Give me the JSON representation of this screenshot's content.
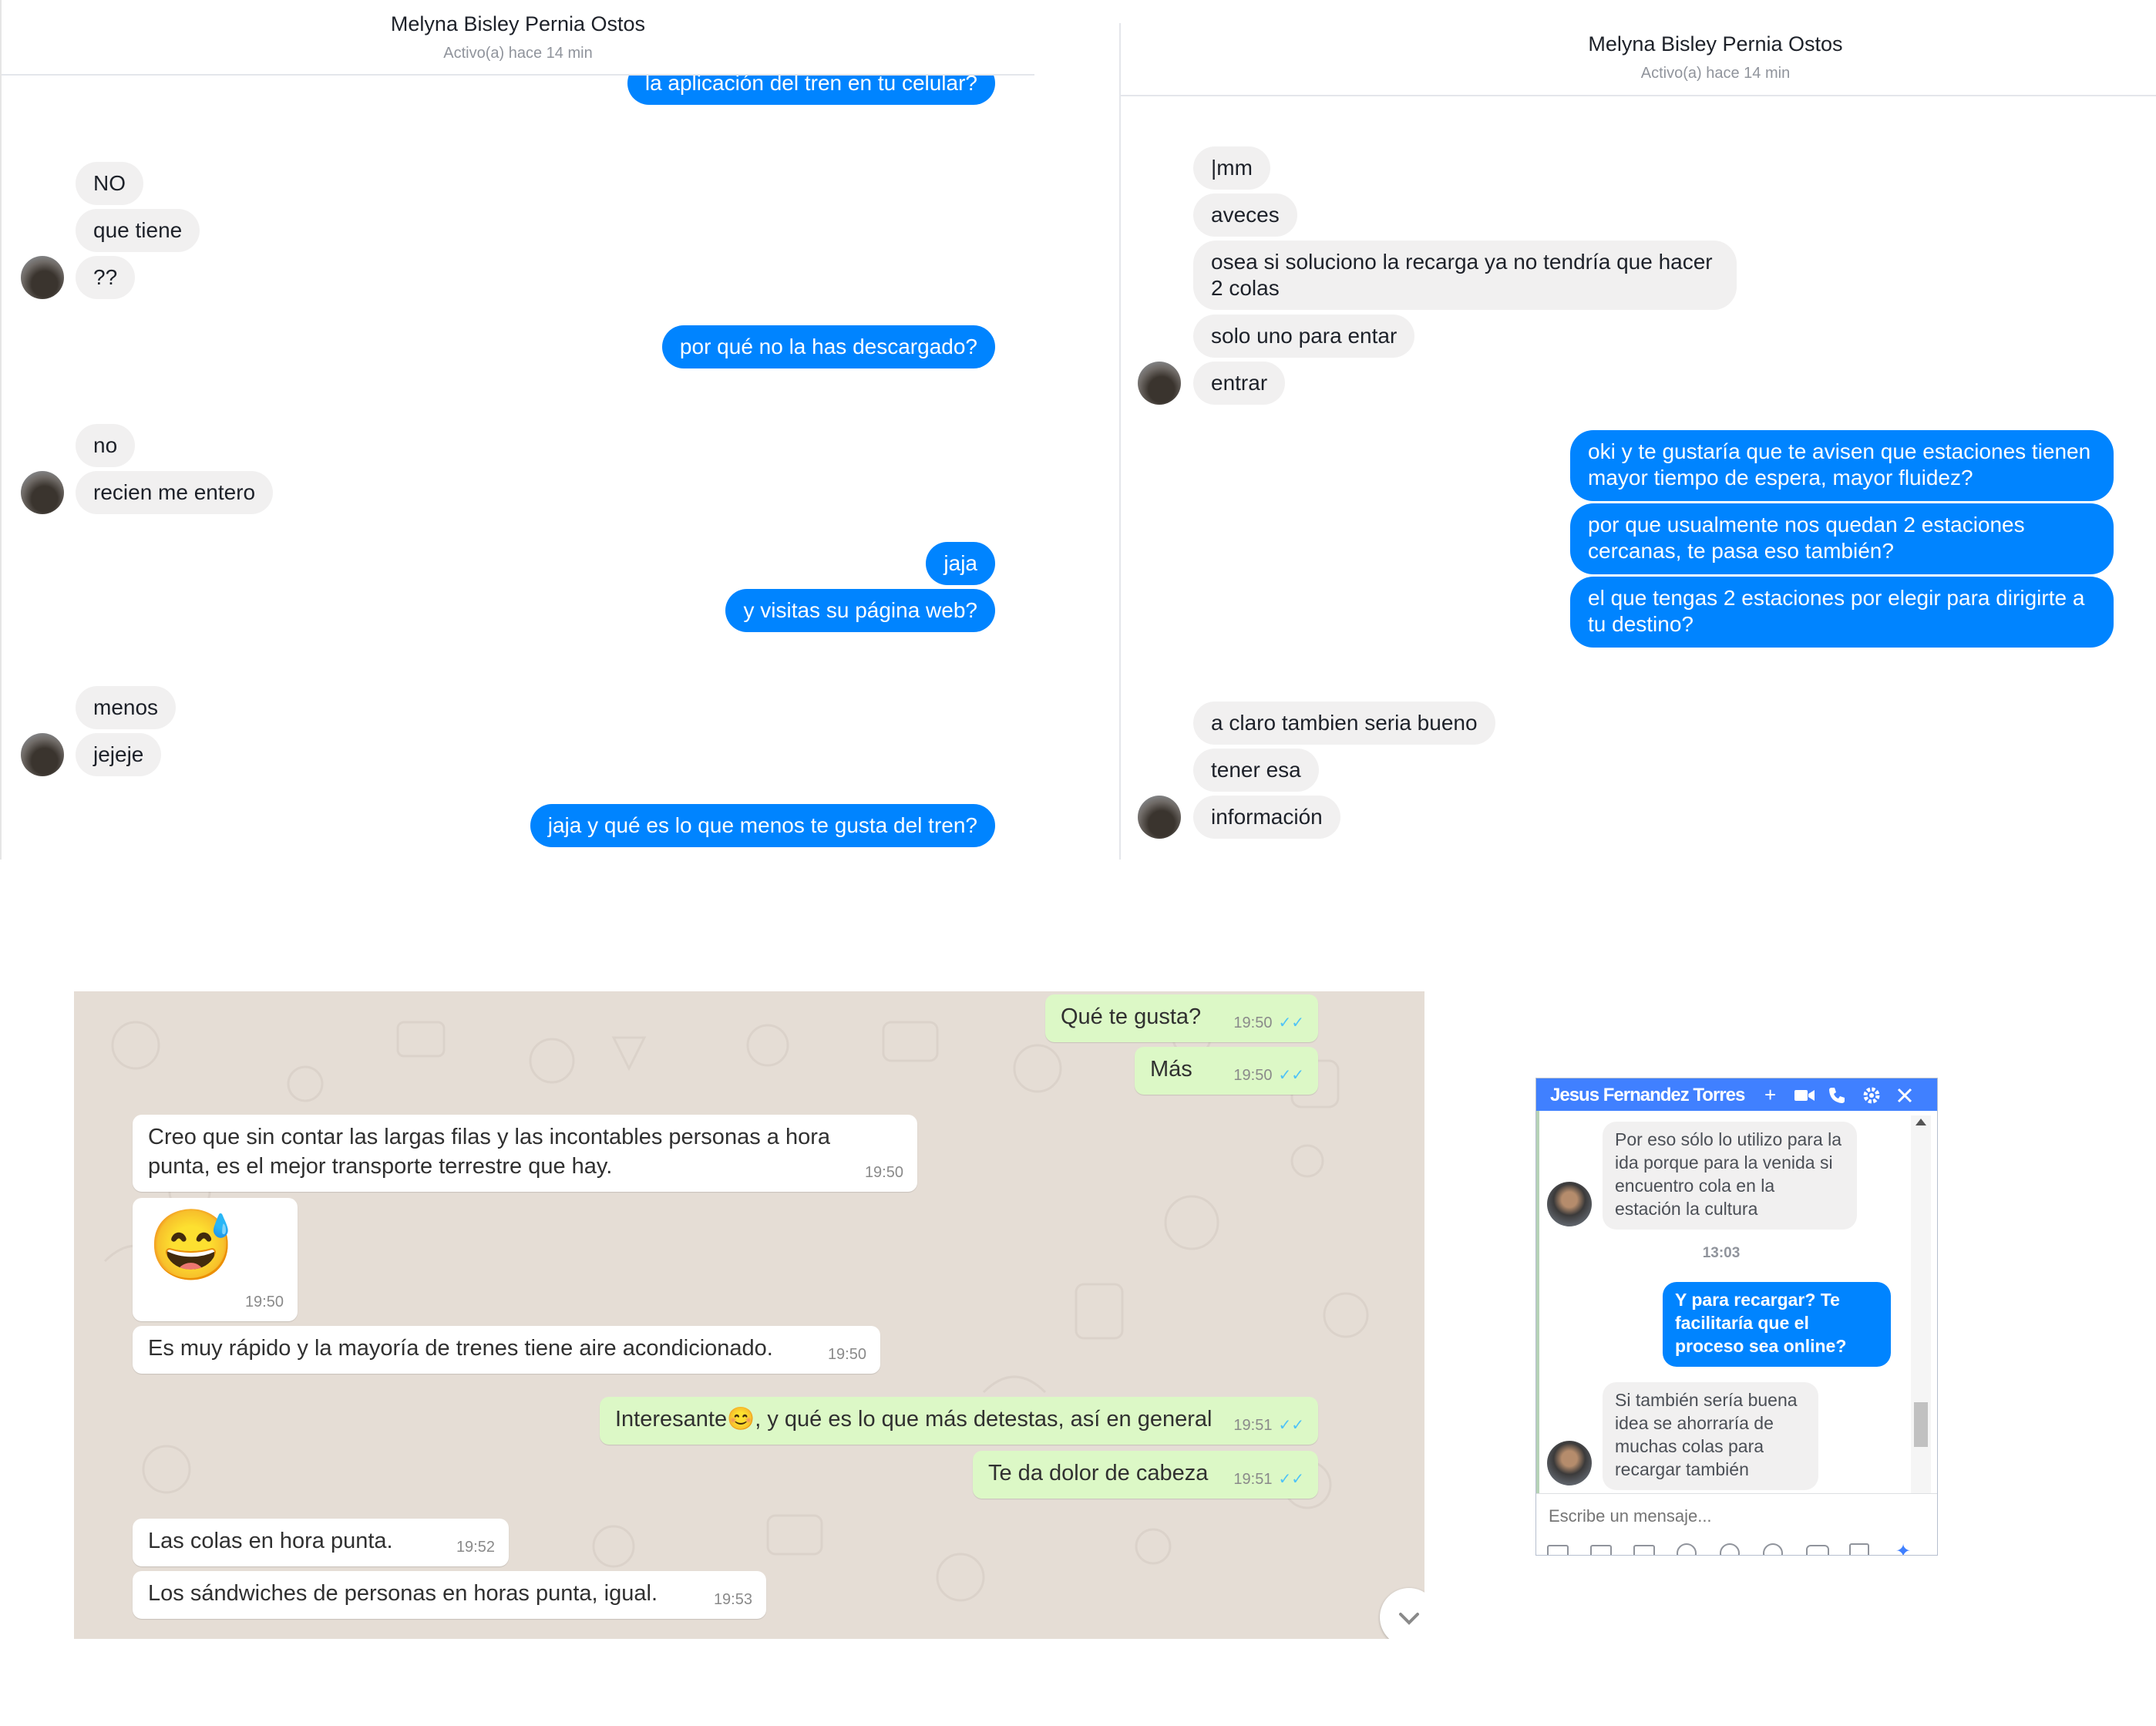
{
  "left_chat": {
    "header": {
      "name": "Melyna Bisley Pernia Ostos",
      "status": "Activo(a) hace 14 min"
    },
    "messages": [
      {
        "from": "me",
        "text": "la aplicación del tren en tu celular?"
      },
      {
        "from": "them",
        "text": "NO"
      },
      {
        "from": "them",
        "text": "que tiene"
      },
      {
        "from": "them",
        "text": "??"
      },
      {
        "from": "me",
        "text": "por qué no la has descargado?"
      },
      {
        "from": "them",
        "text": "no"
      },
      {
        "from": "them",
        "text": "recien me entero"
      },
      {
        "from": "me",
        "text": "jaja"
      },
      {
        "from": "me",
        "text": "y visitas su página web?"
      },
      {
        "from": "them",
        "text": "menos"
      },
      {
        "from": "them",
        "text": "jejeje"
      },
      {
        "from": "me",
        "text": "jaja y qué es lo que menos te gusta del tren?"
      }
    ]
  },
  "right_chat": {
    "header": {
      "name": "Melyna Bisley Pernia Ostos",
      "status": "Activo(a) hace 14 min"
    },
    "messages": [
      {
        "from": "them",
        "text": "|mm"
      },
      {
        "from": "them",
        "text": "aveces"
      },
      {
        "from": "them",
        "text": "osea si soluciono la recarga ya no tendría que hacer 2 colas"
      },
      {
        "from": "them",
        "text": "solo uno para entar"
      },
      {
        "from": "them",
        "text": "entrar"
      },
      {
        "from": "me",
        "text": "oki y te gustaría que te avisen que estaciones tienen mayor tiempo de espera, mayor fluidez?"
      },
      {
        "from": "me",
        "text": "por que usualmente nos quedan 2 estaciones cercanas, te pasa eso también?"
      },
      {
        "from": "me",
        "text": "el que tengas 2 estaciones por elegir para dirigirte a tu destino?"
      },
      {
        "from": "them",
        "text": "a claro tambien seria bueno"
      },
      {
        "from": "them",
        "text": "tener esa"
      },
      {
        "from": "them",
        "text": "información"
      }
    ]
  },
  "whatsapp": {
    "messages": [
      {
        "from": "me",
        "text": "Qué te gusta?",
        "time": "19:50"
      },
      {
        "from": "me",
        "text": "Más",
        "time": "19:50"
      },
      {
        "from": "them",
        "text": "Creo que sin contar las largas filas y las incontables personas a hora punta, es el mejor transporte terrestre que hay.",
        "time": "19:50"
      },
      {
        "from": "them",
        "text": "😅",
        "time": "19:50"
      },
      {
        "from": "them",
        "text": "Es muy rápido y la mayoría de trenes tiene aire acondicionado.",
        "time": "19:50"
      },
      {
        "from": "me",
        "text": "Interesante😊, y qué es lo que más detestas, así en general",
        "time": "19:51"
      },
      {
        "from": "me",
        "text": "Te da dolor de cabeza",
        "time": "19:51"
      },
      {
        "from": "them",
        "text": "Las colas en hora punta.",
        "time": "19:52"
      },
      {
        "from": "them",
        "text": "Los sándwiches de personas en horas punta, igual.",
        "time": "19:53"
      }
    ],
    "read_ticks": "✓✓",
    "scroll_down_icon": "chevron-down-icon"
  },
  "fb_widget": {
    "title": "Jesus Fernandez Torres",
    "header_icons": [
      "plus-icon",
      "video-icon",
      "phone-icon",
      "gear-icon",
      "close-icon"
    ],
    "messages": [
      {
        "from": "them",
        "text": "Por eso sólo lo utilizo para la ida porque para la venida si encuentro cola en la estación la cultura"
      },
      {
        "from": "timestamp",
        "text": "13:03"
      },
      {
        "from": "me",
        "text": "Y para recargar? Te facilitaría que el proceso sea online?"
      },
      {
        "from": "them",
        "text": "Si también sería buena idea se ahorraría de muchas colas para recargar también"
      }
    ],
    "composer_placeholder": "Escribe un mensaje..."
  },
  "colors": {
    "messenger_blue": "#0084ff",
    "messenger_grey": "#f1f0f0",
    "whatsapp_bg": "#e5ddd5",
    "whatsapp_out": "#dcf8c6",
    "fb_header": "#4080ff"
  }
}
